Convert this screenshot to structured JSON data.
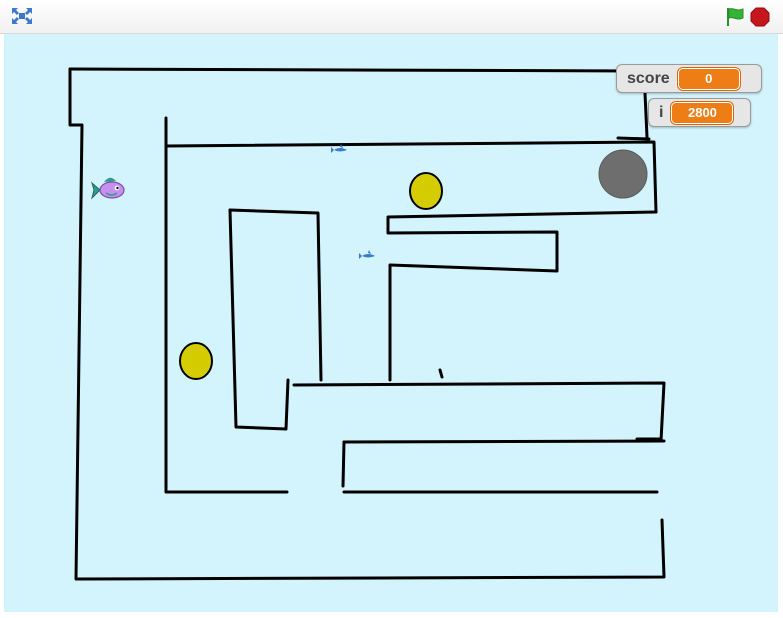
{
  "player_controls": {
    "fullscreen_icon": "fullscreen-icon",
    "green_flag_icon": "green-flag-icon",
    "stop_icon": "stop-icon",
    "flag_color": "#33b533",
    "stop_color": "#c4161c"
  },
  "stage": {
    "background_color": "#d3f4fd",
    "wall_color": "#000000",
    "coin_color": "#d4cc00",
    "ball_color": "#6e6e6e"
  },
  "monitors": {
    "score": {
      "label": "score",
      "value": "0"
    },
    "i": {
      "label": "i",
      "value": "2800"
    }
  },
  "sprites": {
    "player": "fish-sprite",
    "enemies": [
      "shark-sprite",
      "shark-sprite"
    ],
    "coins": [
      "coin",
      "coin"
    ],
    "goal": "gray-ball"
  }
}
